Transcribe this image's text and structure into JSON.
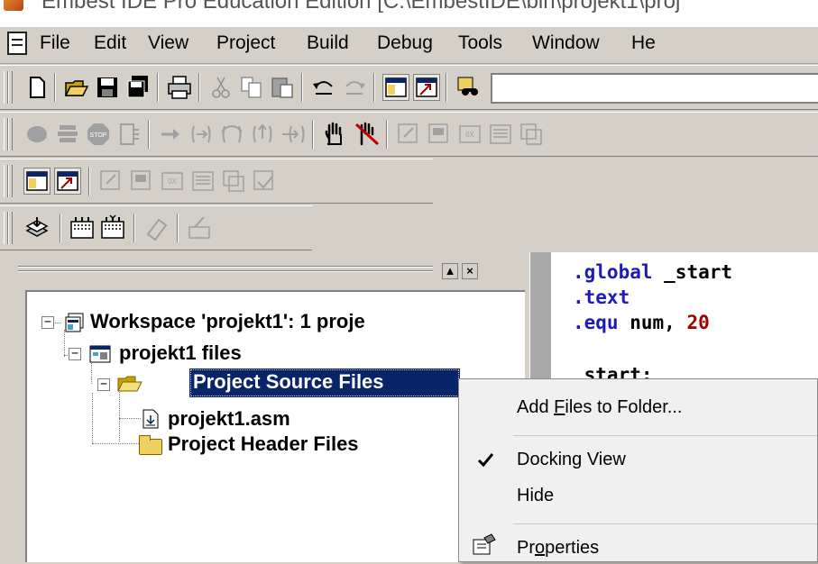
{
  "window": {
    "title": "Embest IDE Pro    Education Edition    [C:\\EmbestIDE\\bin\\projekt1\\proj"
  },
  "menubar": {
    "items": [
      "File",
      "Edit",
      "View",
      "Project",
      "Build",
      "Debug",
      "Tools",
      "Window",
      "He"
    ]
  },
  "toolbars": {
    "standard_icons": [
      "new-file-icon",
      "open-folder-icon",
      "save-icon",
      "save-all-icon",
      "print-icon",
      "cut-icon",
      "copy-icon",
      "paste-icon",
      "undo-icon",
      "redo-icon",
      "workspace-icon",
      "output-icon",
      "find-in-files-icon"
    ],
    "debug_icons": [
      "build-icon",
      "rebuild-icon",
      "stop-icon",
      "go-icon",
      "step-arrow-icon",
      "step-into-icon",
      "step-over-icon",
      "step-out-icon",
      "run-to-cursor-icon",
      "breakpoint-hand-icon",
      "remove-breakpoints-icon",
      "watch-icon",
      "variables-icon",
      "registers-icon",
      "memory-icon",
      "disassembly-icon"
    ],
    "view_icons": [
      "workspace-icon",
      "output-icon",
      "watch-icon",
      "variables-icon",
      "registers-icon",
      "memory-icon",
      "callstack-icon",
      "disassembly-icon"
    ],
    "tools_icons": [
      "download-icon",
      "compile-icon",
      "link-icon",
      "eraser-icon",
      "clean-icon"
    ]
  },
  "workspace_tree": {
    "workspace": "Workspace 'projekt1': 1 proje",
    "project": "projekt1 files",
    "source_folder": "Project Source Files",
    "source_file": "projekt1.asm",
    "header_folder": "Project Header Files"
  },
  "panel_buttons": {
    "minimize": "▲",
    "close": "×"
  },
  "editor": {
    "lines": [
      {
        "kw": ".global",
        "rest": " _start"
      },
      {
        "kw": ".text",
        "rest": ""
      },
      {
        "kw": ".equ",
        "rest": " num, ",
        "num": "20"
      },
      {
        "kw": "",
        "rest": ""
      },
      {
        "kw": "",
        "rest": "_start:"
      }
    ],
    "right_edge_glyphs": [
      ",",
      ",",
      ",",
      ","
    ]
  },
  "context_menu": {
    "add_files": "Add Files to Folder...",
    "add_files_mnemonic": "F",
    "docking_view": "Docking View",
    "docking_view_checked": true,
    "hide": "Hide",
    "properties": "Properties",
    "properties_mnemonic": "o"
  },
  "colors": {
    "selection": "#0a246a",
    "keyword": "#1d1ab8",
    "number": "#a00000",
    "chrome": "#d4d0c8"
  }
}
